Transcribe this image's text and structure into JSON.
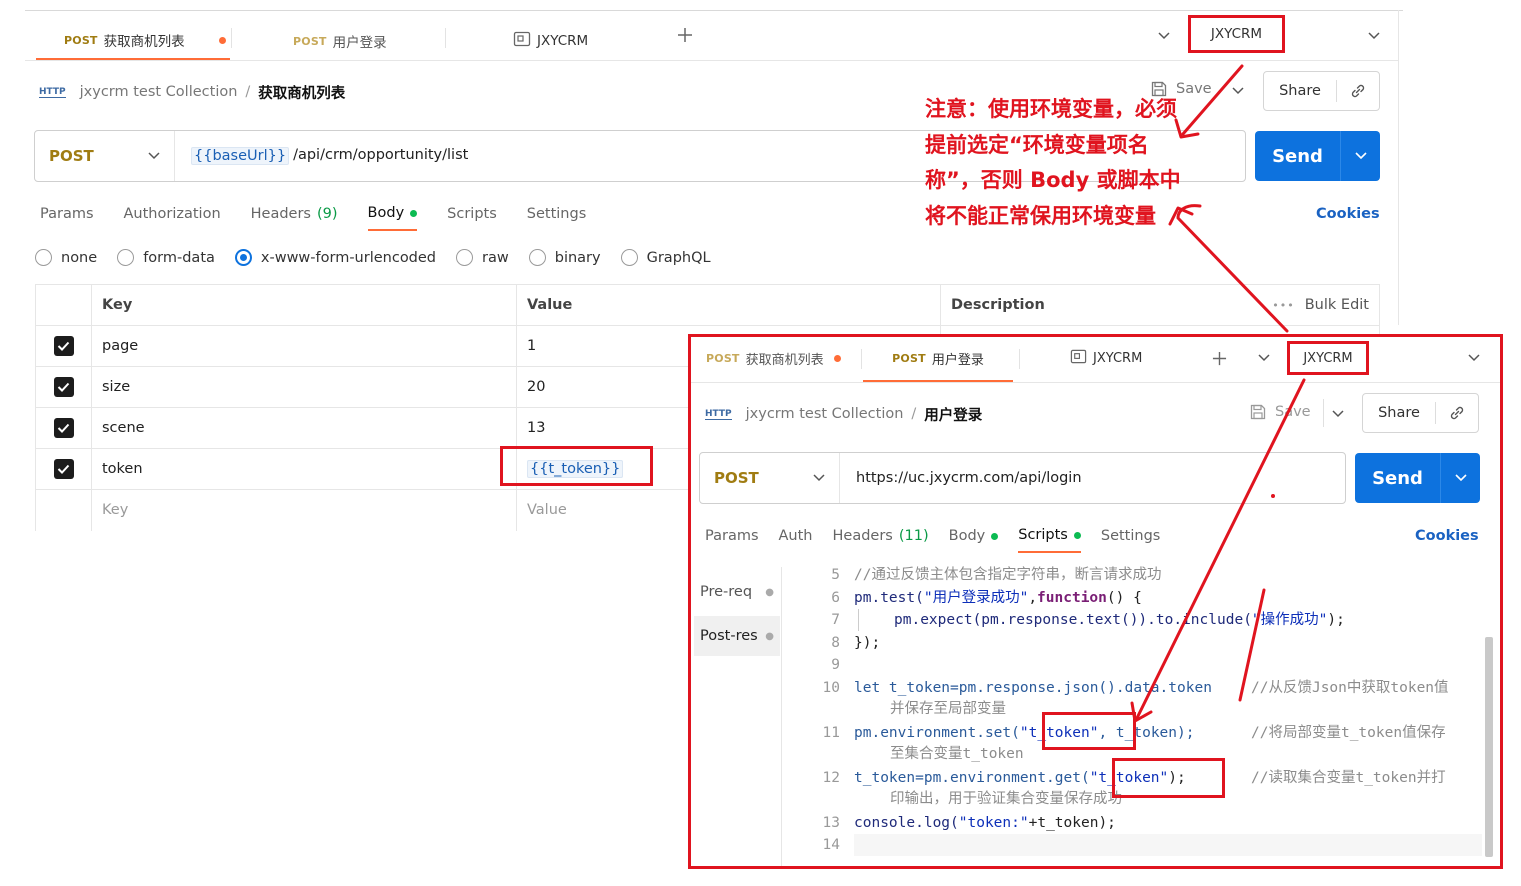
{
  "main": {
    "tabs": [
      {
        "method": "POST",
        "name": "获取商机列表",
        "unsaved": true
      },
      {
        "method": "POST",
        "name": "用户登录"
      },
      {
        "name": "JXYCRM"
      }
    ],
    "environment": "JXYCRM",
    "breadcrumb": {
      "badge": "HTTP",
      "collection": "jxycrm test Collection",
      "separator": "/",
      "request": "获取商机列表"
    },
    "save_label": "Save",
    "share_label": "Share",
    "method": "POST",
    "url_var": "{{baseUrl}}",
    "url_path": "/api/crm/opportunity/list",
    "send_label": "Send",
    "request_tabs": [
      {
        "label": "Params"
      },
      {
        "label": "Authorization"
      },
      {
        "label": "Headers",
        "count": "(9)"
      },
      {
        "label": "Body"
      },
      {
        "label": "Scripts"
      },
      {
        "label": "Settings"
      }
    ],
    "cookies_label": "Cookies",
    "body_types": [
      "none",
      "form-data",
      "x-www-form-urlencoded",
      "raw",
      "binary",
      "GraphQL"
    ],
    "selected_body_type": "x-www-form-urlencoded",
    "table": {
      "headers": [
        "Key",
        "Value",
        "Description"
      ],
      "bulk_edit": "Bulk Edit",
      "rows": [
        {
          "key": "page",
          "value": "1"
        },
        {
          "key": "size",
          "value": "20"
        },
        {
          "key": "scene",
          "value": "13"
        },
        {
          "key": "token",
          "value": "{{t_token}}"
        }
      ],
      "placeholder_key": "Key",
      "placeholder_value": "Value"
    }
  },
  "annotation": {
    "lines": [
      "注意：使用环境变量，必须",
      "提前选定“环境变量项名",
      "称”，否则 Body 或脚本中",
      "将不能正常保用环境变量"
    ]
  },
  "overlay": {
    "tabs": [
      {
        "method": "POST",
        "name": "获取商机列表",
        "unsaved": true
      },
      {
        "method": "POST",
        "name": "用户登录"
      },
      {
        "name": "JXYCRM"
      }
    ],
    "environment": "JXYCRM",
    "breadcrumb": {
      "badge": "HTTP",
      "collection": "jxycrm test Collection",
      "separator": "/",
      "request": "用户登录"
    },
    "save_label": "Save",
    "share_label": "Share",
    "method": "POST",
    "url": "https://uc.jxycrm.com/api/login",
    "send_label": "Send",
    "request_tabs": [
      {
        "label": "Params"
      },
      {
        "label": "Auth"
      },
      {
        "label": "Headers",
        "count": "(11)"
      },
      {
        "label": "Body"
      },
      {
        "label": "Scripts"
      },
      {
        "label": "Settings"
      }
    ],
    "cookies_label": "Cookies",
    "script_tabs": [
      "Pre-req",
      "Post-res"
    ],
    "code": {
      "l5": {
        "n": "5",
        "comment": "//通过反馈主体包含指定字符串，断言请求成功"
      },
      "l6": {
        "n": "6",
        "a": "pm.test(",
        "s": "\"用户登录成功\"",
        "b": ", ",
        "kw": "function",
        "c": " () {"
      },
      "l7": {
        "n": "7",
        "a": "pm.expect(pm.response.text()).to.include(",
        "s": "\"操作成功\"",
        "b": ");"
      },
      "l8": {
        "n": "8",
        "a": "});"
      },
      "l9": {
        "n": "9"
      },
      "l10": {
        "n": "10",
        "a": "let t_token=pm.response.json().data.token",
        "comment": "//从反馈Json中获取token值",
        "cont": "并保存至局部变量"
      },
      "l11": {
        "n": "11",
        "a": "pm.environment.set(",
        "s": "\"t_token\"",
        "b": ", t_token);",
        "comment": "//将局部变量t_token值保存",
        "cont": "至集合变量t_token"
      },
      "l12": {
        "n": "12",
        "a": "t_token=pm.environment.get(",
        "s": "\"t_token\"",
        "b": ");",
        "comment": "//读取集合变量t_token并打",
        "cont": "印输出，用于验证集合变量保存成功"
      },
      "l13": {
        "n": "13",
        "a": "console.log(",
        "s": "\"token:\"",
        "b": "+t_token);"
      },
      "l14": {
        "n": "14"
      }
    }
  },
  "colors": {
    "accent": "#ff6c37",
    "send": "#0d72de",
    "annotation": "#e0141f",
    "method": "#a07c12"
  }
}
